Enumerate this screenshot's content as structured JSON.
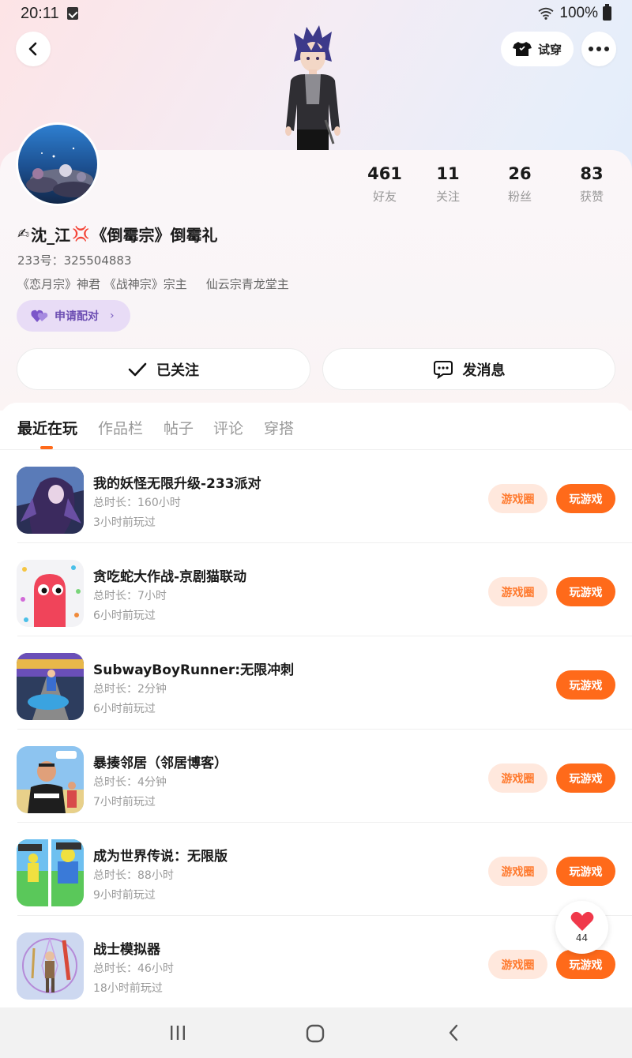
{
  "status_bar": {
    "time": "20:11",
    "battery": "100%",
    "icons": [
      "notification-check-icon",
      "wifi-icon",
      "battery-icon"
    ]
  },
  "header": {
    "back_icon": "chevron-left-icon",
    "tryon_label": "试穿",
    "tryon_icon": "tshirt-icon",
    "more_icon": "more-dots-icon"
  },
  "profile": {
    "nickname": "沈_江",
    "nickname_suffix": "《倒霉宗》倒霉礼",
    "nickname_prefix_emoji": "✍",
    "nickname_mid_emoji": "💢",
    "uid": "233号：325504883",
    "titles": [
      "《恋月宗》神君 《战神宗》宗主",
      "仙云宗青龙堂主"
    ],
    "pair_button": "申请配对",
    "stats": [
      {
        "value": "461",
        "label": "好友"
      },
      {
        "value": "11",
        "label": "关注"
      },
      {
        "value": "26",
        "label": "粉丝"
      },
      {
        "value": "83",
        "label": "获赞"
      }
    ],
    "follow_button": "已关注",
    "message_button": "发消息"
  },
  "tabs": [
    {
      "label": "最近在玩",
      "active": true
    },
    {
      "label": "作品栏",
      "active": false
    },
    {
      "label": "帖子",
      "active": false
    },
    {
      "label": "评论",
      "active": false
    },
    {
      "label": "穿搭",
      "active": false
    }
  ],
  "games": [
    {
      "title": "我的妖怪无限升级-233派对",
      "duration": "总时长：160小时",
      "last_played": "3小时前玩过",
      "circle": "游戏圈",
      "play": "玩游戏"
    },
    {
      "title": "贪吃蛇大作战-京剧猫联动",
      "duration": "总时长：7小时",
      "last_played": "6小时前玩过",
      "circle": "游戏圈",
      "play": "玩游戏"
    },
    {
      "title": "SubwayBoyRunner:无限冲刺",
      "duration": "总时长：2分钟",
      "last_played": "6小时前玩过",
      "circle": "",
      "play": "玩游戏"
    },
    {
      "title": "暴揍邻居（邻居博客）",
      "duration": "总时长：4分钟",
      "last_played": "7小时前玩过",
      "circle": "游戏圈",
      "play": "玩游戏"
    },
    {
      "title": "成为世界传说：无限版",
      "duration": "总时长：88小时",
      "last_played": "9小时前玩过",
      "circle": "游戏圈",
      "play": "玩游戏"
    },
    {
      "title": "战士模拟器",
      "duration": "总时长：46小时",
      "last_played": "18小时前玩过",
      "circle": "游戏圈",
      "play": "玩游戏"
    }
  ],
  "like_fab": {
    "count": "44",
    "icon": "heart-icon"
  },
  "colors": {
    "accent": "#ff6a1a",
    "chip_bg": "#ffe8dd",
    "pair_bg": "#e8dcf6",
    "pair_text": "#6d4fb3"
  },
  "nav_bar": {
    "icons": [
      "recent-apps-icon",
      "home-icon",
      "back-icon"
    ]
  }
}
